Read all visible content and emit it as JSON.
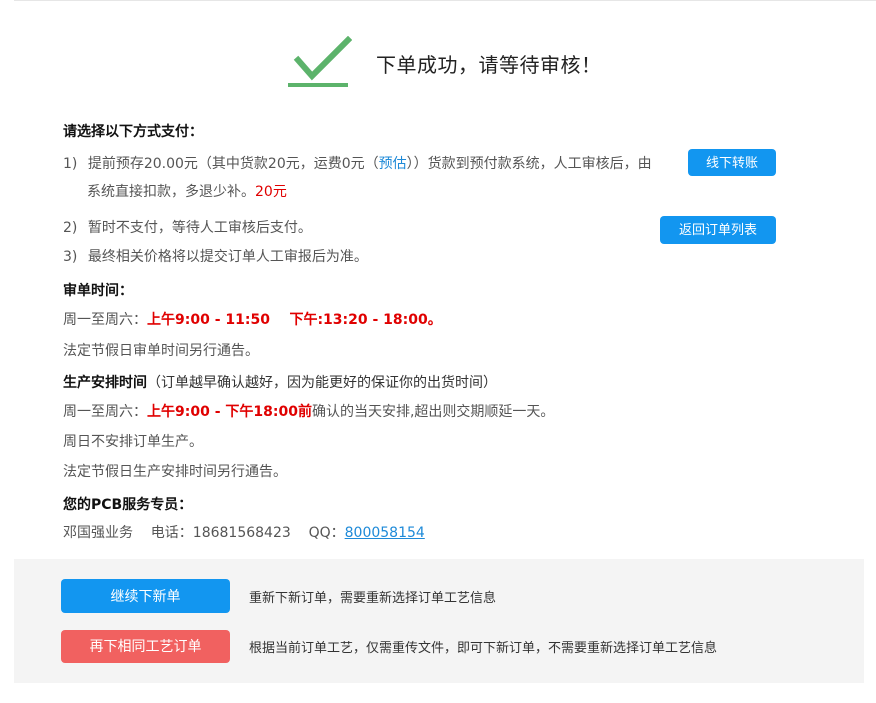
{
  "success": {
    "icon": "checkmark-icon",
    "color": "#5cb36b",
    "message": "下单成功，请等待审核！"
  },
  "payment": {
    "heading": "请选择以下方式支付：",
    "item1": {
      "num": "1)",
      "text_a": "提前预存20.00元（其中货款20元，运费0元（",
      "estimate_link": "预估",
      "text_b": "））货款到预付款系统，人工审核后，由",
      "text_c": "系统直接扣款，多退少补。",
      "amount": "20元"
    },
    "item2": {
      "num": "2)",
      "text": "暂时不支付，等待人工审核后支付。"
    },
    "item3": {
      "num": "3)",
      "text": "最终相关价格将以提交订单人工审报后为准。"
    },
    "offline_button": "线下转账",
    "back_button": "返回订单列表"
  },
  "review": {
    "heading": "审单时间：",
    "prefix": "周一至周六：",
    "hours": "上午9:00 - 11:50    下午:13:20 - 18:00。",
    "holiday": "法定节假日审单时间另行通告。"
  },
  "production": {
    "heading": "生产安排时间",
    "heading_note": "（订单越早确认越好，因为能更好的保证你的出货时间）",
    "prefix": "周一至周六：",
    "hours": "上午9:00 - 下午18:00前",
    "suffix": "确认的当天安排,超出则交期顺延一天。",
    "sunday": "周日不安排订单生产。",
    "holiday": "法定节假日生产安排时间另行通告。"
  },
  "service": {
    "heading": "您的PCB服务专员：",
    "info": "邓国强业务    电话：18681568423    QQ：",
    "qq": "800058154"
  },
  "actions": {
    "new_order_button": "继续下新单",
    "new_order_note": "重新下新订单，需要重新选择订单工艺信息",
    "same_order_button": "再下相同工艺订单",
    "same_order_note": "根据当前订单工艺，仅需重传文件，即可下新订单，不需要重新选择订单工艺信息"
  }
}
